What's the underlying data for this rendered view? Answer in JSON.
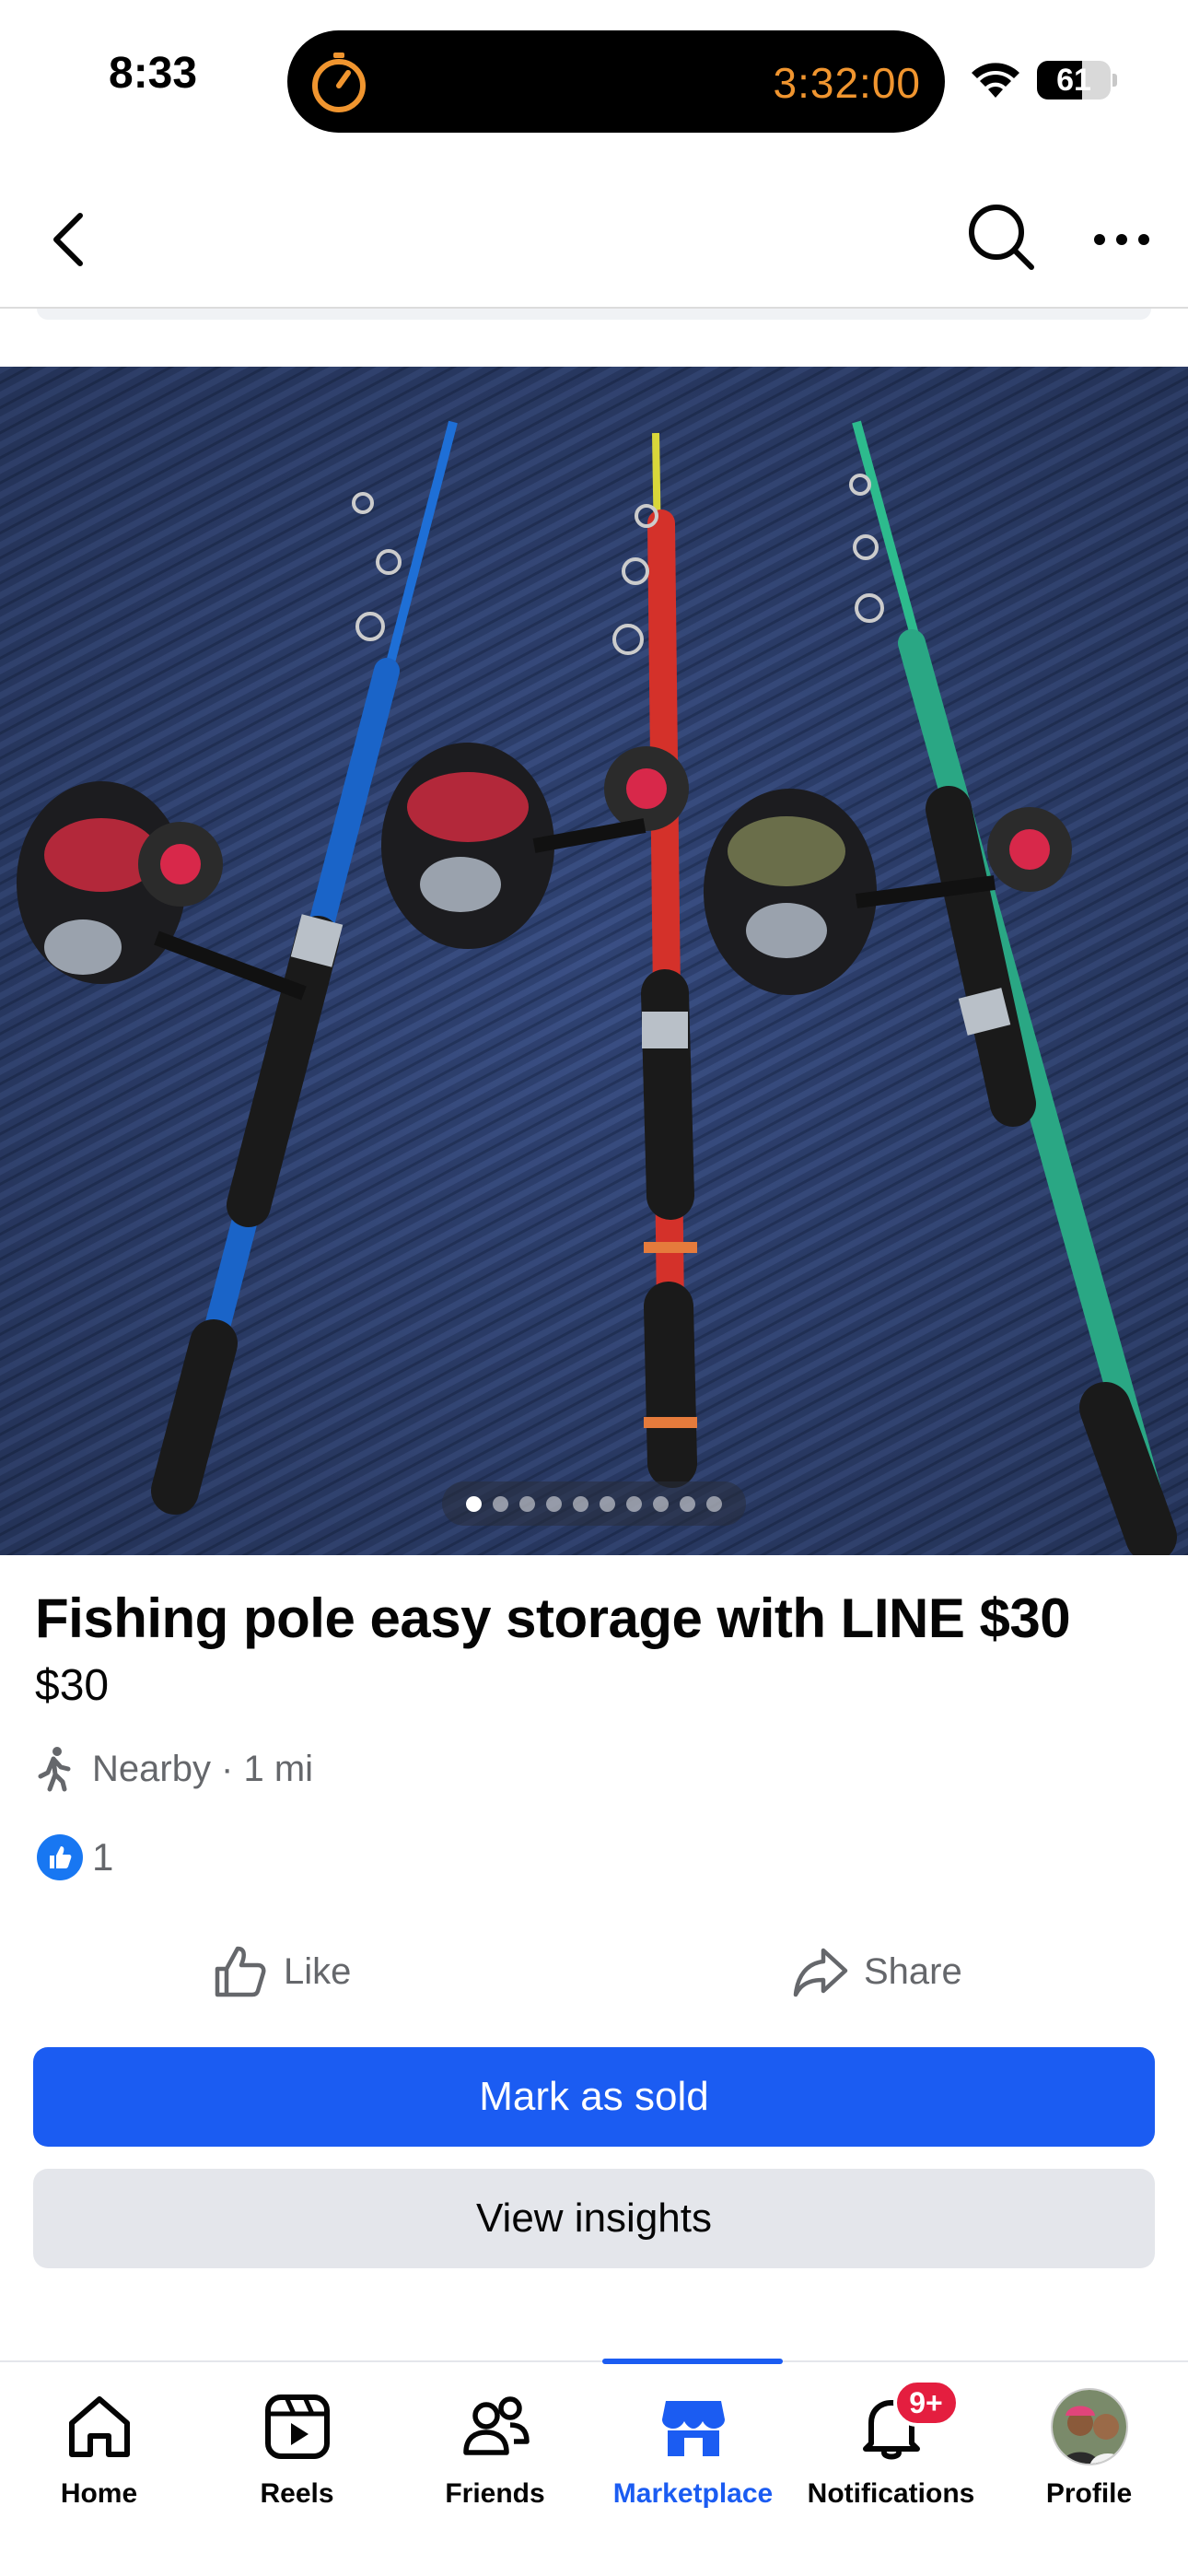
{
  "status_bar": {
    "time": "8:33",
    "timer": "3:32:00",
    "battery": "61",
    "battery_level": 0.61,
    "icons": [
      "timer-icon",
      "wifi-icon",
      "battery-icon"
    ]
  },
  "header": {
    "icons": [
      "back-icon",
      "search-icon",
      "more-icon"
    ]
  },
  "photo": {
    "carousel_total": 10,
    "carousel_active": 1
  },
  "listing": {
    "title": "Fishing pole easy storage with LINE $30",
    "price": "$30",
    "location": "Nearby · 1 mi",
    "reaction_count": "1"
  },
  "actions": {
    "like": "Like",
    "share": "Share",
    "mark_sold": "Mark as sold",
    "view_insights": "View insights"
  },
  "tabs": [
    {
      "label": "Home",
      "icon": "home-icon"
    },
    {
      "label": "Reels",
      "icon": "reels-icon"
    },
    {
      "label": "Friends",
      "icon": "friends-icon"
    },
    {
      "label": "Marketplace",
      "icon": "marketplace-icon",
      "active": true
    },
    {
      "label": "Notifications",
      "icon": "bell-icon",
      "badge": "9+"
    },
    {
      "label": "Profile",
      "icon": "avatar"
    }
  ],
  "colors": {
    "accent": "#1b5cf2",
    "badge": "#e41e3f",
    "timer": "#f0952f",
    "secondary_text": "#65676b"
  }
}
